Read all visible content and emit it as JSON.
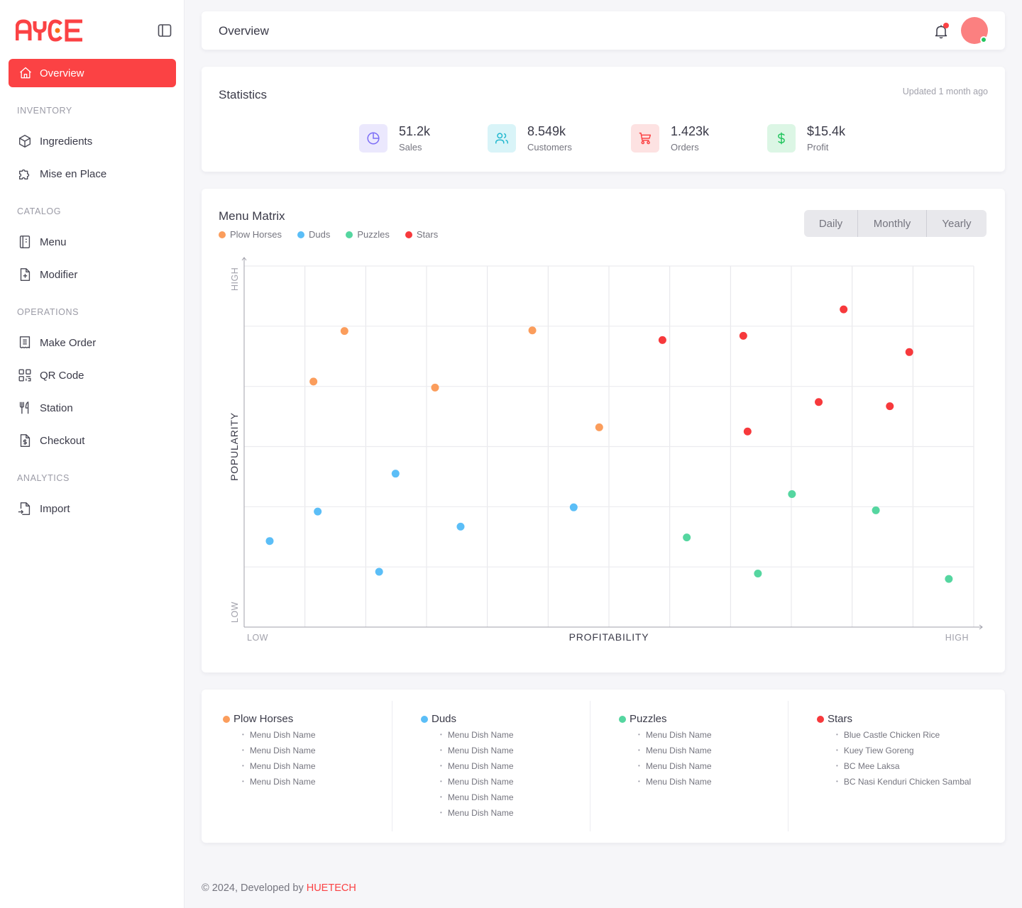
{
  "app": {
    "logo_text": "AYCE",
    "brand_color": "#fb4244"
  },
  "sidebar": {
    "active": {
      "label": "Overview",
      "icon": "home-icon"
    },
    "sections": [
      {
        "label": "INVENTORY",
        "items": [
          {
            "label": "Ingredients",
            "icon": "box-icon"
          },
          {
            "label": "Mise en Place",
            "icon": "puzzle-icon"
          }
        ]
      },
      {
        "label": "CATALOG",
        "items": [
          {
            "label": "Menu",
            "icon": "book-icon"
          },
          {
            "label": "Modifier",
            "icon": "file-plus-icon"
          }
        ]
      },
      {
        "label": "OPERATIONS",
        "items": [
          {
            "label": "Make Order",
            "icon": "receipt-icon"
          },
          {
            "label": "QR Code",
            "icon": "qr-code-icon"
          },
          {
            "label": "Station",
            "icon": "utensils-icon"
          },
          {
            "label": "Checkout",
            "icon": "file-dollar-icon"
          }
        ]
      },
      {
        "label": "ANALYTICS",
        "items": [
          {
            "label": "Import",
            "icon": "file-import-icon"
          }
        ]
      }
    ]
  },
  "header": {
    "title": "Overview",
    "notification_dot": true,
    "avatar_status": "online"
  },
  "statistics": {
    "title": "Statistics",
    "updated": "Updated 1 month ago",
    "items": [
      {
        "value": "51.2k",
        "label": "Sales",
        "icon": "pie-chart-icon",
        "color": "#7b6cf6",
        "bg": "#ebe8fd"
      },
      {
        "value": "8.549k",
        "label": "Customers",
        "icon": "users-icon",
        "color": "#22b8cf",
        "bg": "#d9f4f8"
      },
      {
        "value": "1.423k",
        "label": "Orders",
        "icon": "cart-icon",
        "color": "#fb4244",
        "bg": "#fde2e2"
      },
      {
        "value": "$15.4k",
        "label": "Profit",
        "icon": "dollar-icon",
        "color": "#22c55e",
        "bg": "#dcf6e5"
      }
    ]
  },
  "matrix": {
    "title": "Menu Matrix",
    "periods": [
      "Daily",
      "Monthly",
      "Yearly"
    ]
  },
  "chart_data": {
    "type": "scatter",
    "title": "Menu Matrix",
    "xlabel": "PROFITABILITY",
    "ylabel": "POPULARITY",
    "x_low_label": "LOW",
    "x_high_label": "HIGH",
    "y_low_label": "LOW",
    "y_high_label": "HIGH",
    "xlim": [
      0,
      12
    ],
    "ylim": [
      0,
      6
    ],
    "grid": true,
    "legend": "top-left",
    "series": [
      {
        "name": "Plow Horses",
        "color": "#fb9d5c",
        "points": [
          [
            1.65,
            4.92
          ],
          [
            1.14,
            4.08
          ],
          [
            3.14,
            3.98
          ],
          [
            4.74,
            4.93
          ],
          [
            5.84,
            3.32
          ]
        ]
      },
      {
        "name": "Duds",
        "color": "#5bbef7",
        "points": [
          [
            0.42,
            1.43
          ],
          [
            1.21,
            1.92
          ],
          [
            2.49,
            2.55
          ],
          [
            2.22,
            0.92
          ],
          [
            3.56,
            1.67
          ],
          [
            5.42,
            1.99
          ]
        ]
      },
      {
        "name": "Puzzles",
        "color": "#55d6a0",
        "points": [
          [
            7.28,
            1.49
          ],
          [
            8.45,
            0.89
          ],
          [
            9.01,
            2.21
          ],
          [
            10.39,
            1.94
          ],
          [
            11.59,
            0.8
          ]
        ]
      },
      {
        "name": "Stars",
        "color": "#f7393c",
        "points": [
          [
            6.88,
            4.77
          ],
          [
            8.21,
            4.84
          ],
          [
            9.86,
            5.28
          ],
          [
            10.94,
            4.57
          ],
          [
            9.45,
            3.74
          ],
          [
            10.62,
            3.67
          ],
          [
            8.28,
            3.25
          ]
        ]
      }
    ]
  },
  "categories": [
    {
      "name": "Plow Horses",
      "color": "#fb9d5c",
      "dishes": [
        "Menu Dish Name",
        "Menu Dish Name",
        "Menu Dish Name",
        "Menu Dish Name"
      ]
    },
    {
      "name": "Duds",
      "color": "#5bbef7",
      "dishes": [
        "Menu Dish Name",
        "Menu Dish Name",
        "Menu Dish Name",
        "Menu Dish Name",
        "Menu Dish Name",
        "Menu Dish Name"
      ]
    },
    {
      "name": "Puzzles",
      "color": "#55d6a0",
      "dishes": [
        "Menu Dish Name",
        "Menu Dish Name",
        "Menu Dish Name",
        "Menu Dish Name"
      ]
    },
    {
      "name": "Stars",
      "color": "#f7393c",
      "dishes": [
        "Blue Castle Chicken Rice",
        "Kuey Tiew  Goreng",
        "BC Mee Laksa",
        "BC Nasi Kenduri Chicken Sambal"
      ]
    }
  ],
  "footer": {
    "text": "© 2024, Developed by",
    "brand": "HUETECH"
  }
}
